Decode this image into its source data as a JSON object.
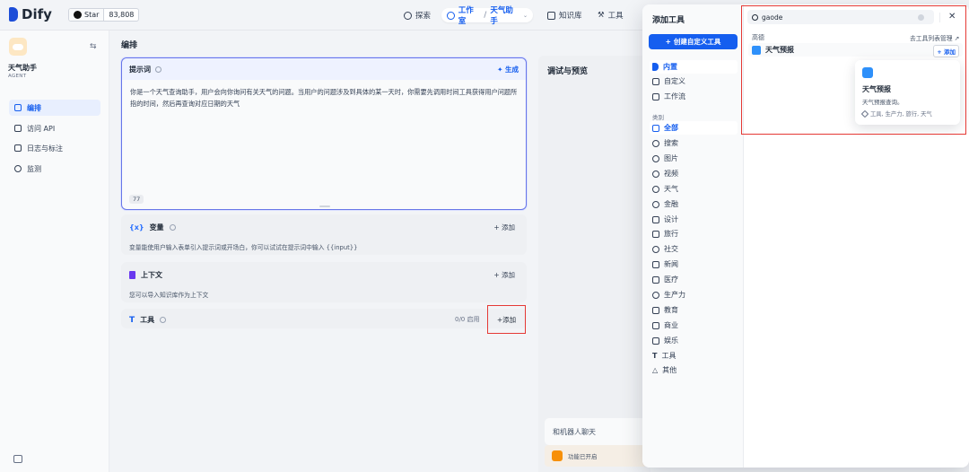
{
  "app": {
    "logo": "Dify",
    "star_label": "Star",
    "star_count": "83,808"
  },
  "topnav": {
    "explore": "探索",
    "studio": "工作室",
    "app_selected": "天气助手",
    "knowledge": "知识库",
    "tools": "工具"
  },
  "sidebar": {
    "app_name": "天气助手",
    "app_type": "AGENT",
    "items": [
      {
        "label": "编排",
        "icon": "layout-icon",
        "active": true
      },
      {
        "label": "访问 API",
        "icon": "api-icon",
        "active": false
      },
      {
        "label": "日志与标注",
        "icon": "logs-icon",
        "active": false
      },
      {
        "label": "监测",
        "icon": "monitor-icon",
        "active": false
      }
    ]
  },
  "main": {
    "section_title": "编排",
    "prompt": {
      "title": "提示词",
      "generate_label": "生成",
      "text": "你是一个天气查询助手，用户会向你询问有关天气的问题。当用户的问题涉及到具体的某一天时，你需要先调用时间工具获得用户问题所指的时间，然后再查询对应日期的天气",
      "char_count": "77"
    },
    "variables": {
      "title": "变量",
      "add": "添加",
      "desc": "变量能使用户输入表单引入提示词或开场白，你可以试试在提示词中输入 {{input}}"
    },
    "context": {
      "title": "上下文",
      "add": "添加",
      "desc": "您可以导入知识库作为上下文"
    },
    "tools": {
      "title": "工具",
      "enabled": "0/0 启用",
      "add": "添加"
    }
  },
  "debug": {
    "title": "调试与预览",
    "chat_label": "和机器人聊天",
    "feature_label": "功能已开启"
  },
  "tool_panel": {
    "title": "添加工具",
    "create_button": "创建自定义工具",
    "sources": [
      {
        "label": "内置",
        "active": true
      },
      {
        "label": "自定义",
        "active": false
      },
      {
        "label": "工作流",
        "active": false
      }
    ],
    "category_heading": "类别",
    "categories": [
      {
        "label": "全部",
        "active": true
      },
      {
        "label": "搜索",
        "active": false
      },
      {
        "label": "图片",
        "active": false
      },
      {
        "label": "视频",
        "active": false
      },
      {
        "label": "天气",
        "active": false
      },
      {
        "label": "金融",
        "active": false
      },
      {
        "label": "设计",
        "active": false
      },
      {
        "label": "旅行",
        "active": false
      },
      {
        "label": "社交",
        "active": false
      },
      {
        "label": "新闻",
        "active": false
      },
      {
        "label": "医疗",
        "active": false
      },
      {
        "label": "生产力",
        "active": false
      },
      {
        "label": "教育",
        "active": false
      },
      {
        "label": "商业",
        "active": false
      },
      {
        "label": "娱乐",
        "active": false
      },
      {
        "label": "工具",
        "active": false
      },
      {
        "label": "其他",
        "active": false
      }
    ],
    "search": {
      "value": "gaode",
      "placeholder": ""
    },
    "provider_name": "高德",
    "goto_manage": "去工具列表管理 ↗",
    "result": {
      "name": "天气预报",
      "add": "+ 添加"
    },
    "tooltip": {
      "name": "天气预报",
      "desc": "天气预报查询。",
      "tags": "工具, 生产力, 旅行, 天气"
    }
  }
}
